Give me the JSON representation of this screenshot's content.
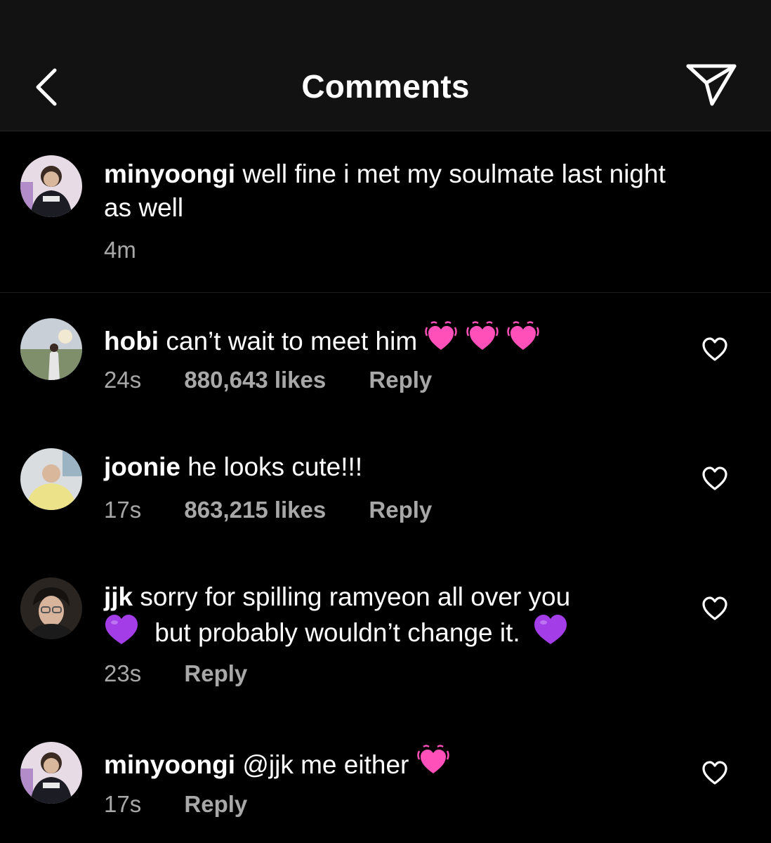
{
  "header": {
    "title": "Comments"
  },
  "icons": {
    "back": "chevron-left-icon",
    "share": "paper-plane-icon",
    "like": "heart-outline-icon"
  },
  "caption": {
    "username": "minyoongi",
    "text_line1": "well fine i met my soulmate last night",
    "text_line2": "as well",
    "time": "4m"
  },
  "comments": [
    {
      "username": "hobi",
      "text": "can’t wait to meet him",
      "emoji": [
        "pink-vibrating-heart",
        "pink-vibrating-heart",
        "pink-vibrating-heart"
      ],
      "time": "24s",
      "likes": "880,643 likes",
      "reply": "Reply"
    },
    {
      "username": "joonie",
      "text": "he looks cute!!!",
      "time": "17s",
      "likes": "863,215 likes",
      "reply": "Reply"
    },
    {
      "username": "jjk",
      "text_line1": "sorry for spilling ramyeon all over you",
      "text_line2": "but probably wouldn’t change it.",
      "emoji": [
        "purple-heart",
        "purple-heart"
      ],
      "time": "23s",
      "reply": "Reply"
    },
    {
      "username": "minyoongi",
      "text": "@jjk me either",
      "emoji": [
        "pink-vibrating-heart"
      ],
      "time": "17s",
      "reply": "Reply"
    }
  ],
  "colors": {
    "background": "#000000",
    "header": "#121212",
    "muted": "#a8a8a8",
    "pink_heart": "#ff4fb8",
    "purple_heart": "#a23de8"
  }
}
